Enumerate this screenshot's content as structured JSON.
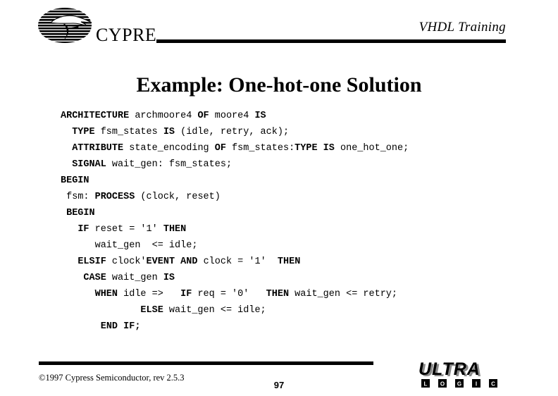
{
  "header": {
    "brand_name": "CYPRESS",
    "brand_logo_icon": "cypress-bird-oval-logo",
    "course_title": "VHDL Training"
  },
  "title": "Example: One-hot-one Solution",
  "code": {
    "language": "VHDL",
    "lines": [
      [
        {
          "t": "ARCHITECTURE",
          "b": true
        },
        {
          "t": " archmoore4 ",
          "b": false
        },
        {
          "t": "OF",
          "b": true
        },
        {
          "t": " moore4 ",
          "b": false
        },
        {
          "t": "IS",
          "b": true
        }
      ],
      [
        {
          "t": "  ",
          "b": false
        },
        {
          "t": "TYPE",
          "b": true
        },
        {
          "t": " fsm_states ",
          "b": false
        },
        {
          "t": "IS",
          "b": true
        },
        {
          "t": " (idle, retry, ack);",
          "b": false
        }
      ],
      [
        {
          "t": "  ",
          "b": false
        },
        {
          "t": "ATTRIBUTE",
          "b": true
        },
        {
          "t": " state_encoding ",
          "b": false
        },
        {
          "t": "OF",
          "b": true
        },
        {
          "t": " fsm_states:",
          "b": false
        },
        {
          "t": "TYPE IS",
          "b": true
        },
        {
          "t": " one_hot_one;",
          "b": false
        }
      ],
      [
        {
          "t": "  ",
          "b": false
        },
        {
          "t": "SIGNAL",
          "b": true
        },
        {
          "t": " wait_gen: fsm_states;",
          "b": false
        }
      ],
      [
        {
          "t": "BEGIN",
          "b": true
        }
      ],
      [
        {
          "t": " fsm: ",
          "b": false
        },
        {
          "t": "PROCESS",
          "b": true
        },
        {
          "t": " (clock, reset)",
          "b": false
        }
      ],
      [
        {
          "t": " ",
          "b": false
        },
        {
          "t": "BEGIN",
          "b": true
        }
      ],
      [
        {
          "t": "   ",
          "b": false
        },
        {
          "t": "IF",
          "b": true
        },
        {
          "t": " reset = '1' ",
          "b": false
        },
        {
          "t": "THEN",
          "b": true
        }
      ],
      [
        {
          "t": "      wait_gen  <= idle;",
          "b": false
        }
      ],
      [
        {
          "t": "   ",
          "b": false
        },
        {
          "t": "ELSIF",
          "b": true
        },
        {
          "t": " clock'",
          "b": false
        },
        {
          "t": "EVENT AND",
          "b": true
        },
        {
          "t": " clock = '1'  ",
          "b": false
        },
        {
          "t": "THEN",
          "b": true
        }
      ],
      [
        {
          "t": "    ",
          "b": false
        },
        {
          "t": "CASE",
          "b": true
        },
        {
          "t": " wait_gen ",
          "b": false
        },
        {
          "t": "IS",
          "b": true
        }
      ],
      [
        {
          "t": "      ",
          "b": false
        },
        {
          "t": "WHEN",
          "b": true
        },
        {
          "t": " idle =>   ",
          "b": false
        },
        {
          "t": "IF",
          "b": true
        },
        {
          "t": " req = '0'   ",
          "b": false
        },
        {
          "t": "THEN",
          "b": true
        },
        {
          "t": " wait_gen <= retry;",
          "b": false
        }
      ],
      [
        {
          "t": "              ",
          "b": false
        },
        {
          "t": "ELSE",
          "b": true
        },
        {
          "t": " wait_gen <= idle;",
          "b": false
        }
      ],
      [
        {
          "t": "       ",
          "b": false
        },
        {
          "t": "END IF;",
          "b": true
        }
      ]
    ]
  },
  "footer": {
    "copyright": "©1997 Cypress Semiconductor, rev 2.5.3",
    "page_number": "97",
    "logo_wordmark": "ULTRA",
    "logo_subtext": "LOGIC",
    "logo_subtext_letters": [
      "L",
      "O",
      "G",
      "I",
      "C"
    ],
    "logo_icon": "ultra-logic-wordmark"
  },
  "colors": {
    "text": "#000000",
    "background": "#ffffff",
    "rule": "#000000",
    "logo_gray": "#8a8a8a"
  }
}
